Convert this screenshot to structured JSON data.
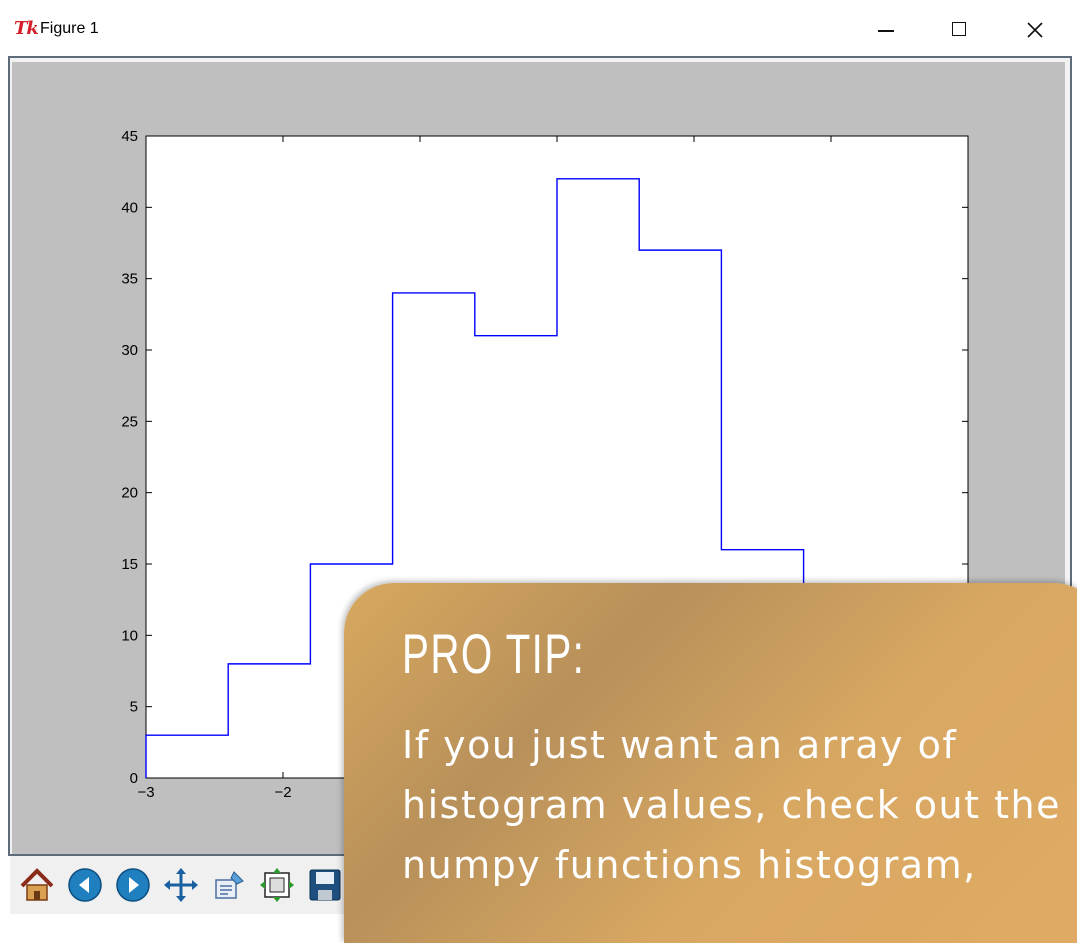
{
  "window": {
    "title": "Figure 1",
    "app_logo": "Tk"
  },
  "titlebar_buttons": [
    "minimize-icon",
    "maximize-icon",
    "close-icon"
  ],
  "chart_data": {
    "type": "line",
    "subtype": "step-histogram",
    "xlim": [
      -3,
      3
    ],
    "ylim": [
      0,
      45
    ],
    "xticks": [
      "−3",
      "−2"
    ],
    "yticks": [
      "0",
      "5",
      "10",
      "15",
      "20",
      "25",
      "30",
      "35",
      "40",
      "45"
    ],
    "series": [
      {
        "color": "#0000ff",
        "bin_edges": [
          -3.0,
          -2.4,
          -1.8,
          -1.2,
          -0.6,
          0.0,
          0.6,
          1.2,
          1.8
        ],
        "counts": [
          3,
          8,
          15,
          34,
          31,
          42,
          37,
          16
        ]
      }
    ]
  },
  "toolbar": {
    "buttons": [
      "home-icon",
      "back-icon",
      "forward-icon",
      "pan-icon",
      "zoom-icon",
      "configure-subplots-icon",
      "save-icon"
    ]
  },
  "tip": {
    "title": "PRO TIP:",
    "body_lines": [
      "If you just want an array of",
      "histogram values, check out the",
      "numpy functions histogram,"
    ]
  }
}
